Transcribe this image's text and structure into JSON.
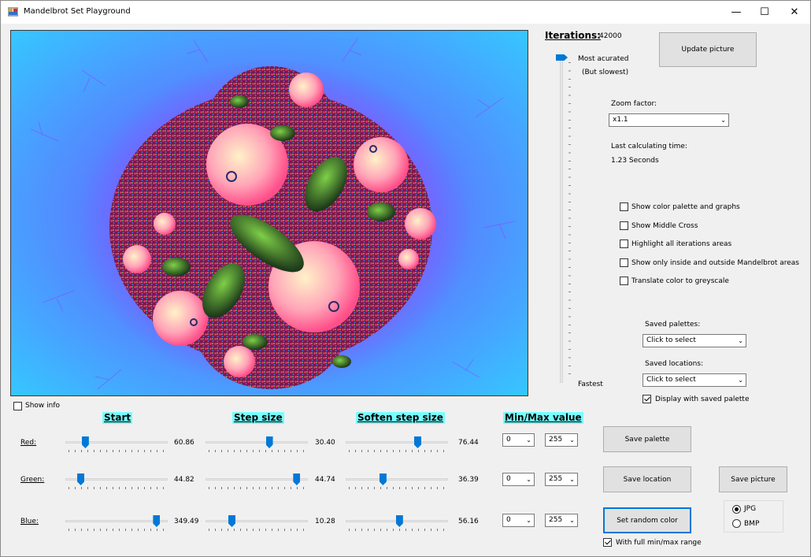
{
  "window": {
    "title": "Mandelbrot Set Playground",
    "minimize": "—",
    "maximize": "☐",
    "close": "✕"
  },
  "show_info": {
    "label": "Show info",
    "checked": false
  },
  "iterations": {
    "label": "Iterations:",
    "value": "42000",
    "top_label": "Most acurated",
    "top_sublabel": "(But slowest)",
    "bottom_label": "Fastest"
  },
  "update_button": "Update picture",
  "zoom": {
    "label": "Zoom factor:",
    "value": "x1.1"
  },
  "calc_time": {
    "label": "Last calculating time:",
    "value": "1.23 Seconds"
  },
  "options": [
    {
      "label": "Show color palette and graphs",
      "checked": false
    },
    {
      "label": "Show Middle Cross",
      "checked": false
    },
    {
      "label": "Highlight all iterations areas",
      "checked": false
    },
    {
      "label": "Show only inside and outside Mandelbrot areas",
      "checked": false
    },
    {
      "label": "Translate color to greyscale",
      "checked": false
    }
  ],
  "saved_palettes": {
    "label": "Saved palettes:",
    "value": "Click to select"
  },
  "saved_locations": {
    "label": "Saved locations:",
    "value": "Click to select"
  },
  "display_saved_palette": {
    "label": "Display with saved palette",
    "checked": true
  },
  "headers": {
    "start": "Start",
    "step": "Step size",
    "soften": "Soften step size",
    "minmax": "Min/Max value"
  },
  "rows": [
    {
      "label": "Red:",
      "start": "60.86",
      "step": "30.40",
      "soften": "76.44",
      "min": "0",
      "max": "255",
      "start_pos": 0.18,
      "step_pos": 0.66,
      "soften_pos": 0.75
    },
    {
      "label": "Green:",
      "start": "44.82",
      "step": "44.74",
      "soften": "36.39",
      "min": "0",
      "max": "255",
      "start_pos": 0.13,
      "step_pos": 0.96,
      "soften_pos": 0.37
    },
    {
      "label": "Blue:",
      "start": "349.49",
      "step": "10.28",
      "soften": "56.16",
      "min": "0",
      "max": "255",
      "start_pos": 0.96,
      "step_pos": 0.25,
      "soften_pos": 0.55
    }
  ],
  "buttons": {
    "save_palette": "Save  palette",
    "save_location": "Save location",
    "save_picture": "Save picture",
    "random_color": "Set random color"
  },
  "full_range": {
    "label": "With full min/max range",
    "checked": true
  },
  "format": {
    "jpg": "JPG",
    "bmp": "BMP",
    "selected": "JPG"
  },
  "colors": {
    "accent": "#0078d7",
    "header_bg": "#77ffff"
  }
}
